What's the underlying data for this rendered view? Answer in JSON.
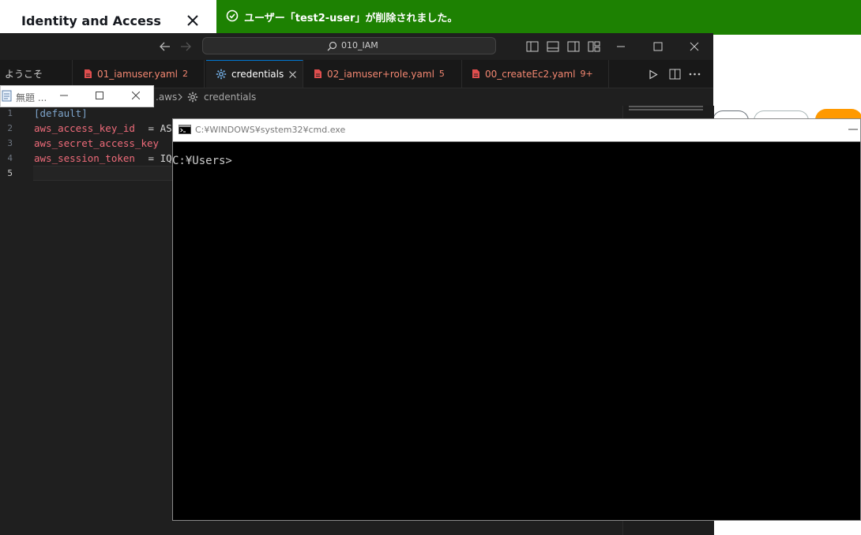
{
  "aws": {
    "panel_title": "Identity and Access",
    "flash_message": "ユーザー「test2-user」が削除されました。",
    "colors": {
      "flash_bg": "#1d8102",
      "primary_button": "#ff9900"
    }
  },
  "vscode": {
    "search_text": "010_IAM",
    "welcome_tab": "ようこそ",
    "tabs": [
      {
        "label": "01_iamuser.yaml",
        "badge": "2",
        "icon": "yaml-file-icon"
      },
      {
        "label": "credentials",
        "badge": "",
        "icon": "gear-icon"
      },
      {
        "label": "02_iamuser+role.yaml",
        "badge": "5",
        "icon": "yaml-file-icon"
      },
      {
        "label": "00_createEc2.yaml",
        "badge": "9+",
        "icon": "yaml-file-icon"
      }
    ],
    "breadcrumb": {
      "folder": ".aws",
      "file": "credentials"
    },
    "code_lines": [
      {
        "num": "1",
        "text": "[default]"
      },
      {
        "num": "2",
        "key": "aws_access_key_id",
        "rest": " = AS"
      },
      {
        "num": "3",
        "key": "aws_secret_access_key",
        "rest": ""
      },
      {
        "num": "4",
        "key": "aws_session_token",
        "rest": " = IQ"
      },
      {
        "num": "5",
        "text": ""
      }
    ]
  },
  "notepad": {
    "title": "無題 ..."
  },
  "cmd": {
    "title": "C:¥WINDOWS¥system32¥cmd.exe",
    "prompt": "C:¥Users>"
  }
}
